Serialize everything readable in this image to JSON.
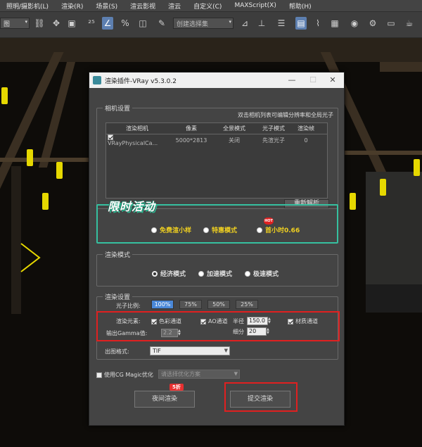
{
  "menubar": {
    "items": [
      "照明/摄影机(L)",
      "渲染(R)",
      "场景(S)",
      "渲云影视",
      "渲云",
      "自定义(C)",
      "MAXScript(X)",
      "帮助(H)"
    ]
  },
  "toolbar": {
    "view_select": "图",
    "named_selection": "创建选择集"
  },
  "dialog": {
    "title": "渲染插件-VRay v5.3.0.2",
    "minimize": "—",
    "maximize": "☐",
    "close": "✕",
    "camera": {
      "group_title": "相机设置",
      "hint": "双击相机列表可编辑分辨率和全局光子",
      "columns": [
        "渲染相机",
        "像素",
        "全景模式",
        "光子模式",
        "渲染帧"
      ],
      "rows": [
        {
          "camera": "VRayPhysicalCa...",
          "pixels": "5000*2813",
          "panorama": "关闭",
          "photon": "先渲光子",
          "frame": "0"
        }
      ],
      "reparse": "重新解析"
    },
    "promo": {
      "title": "限时活动",
      "options": [
        "免费渲小样",
        "特惠模式",
        "首小时0.66"
      ],
      "hot": "HOT"
    },
    "render_mode": {
      "group_title": "渲染模式",
      "options": [
        "经济模式",
        "加速模式",
        "极速模式"
      ]
    },
    "render_settings": {
      "group_title": "渲染设置",
      "photon_ratio_label": "光子比例:",
      "ratios": [
        "100%",
        "75%",
        "50%",
        "25%"
      ],
      "elements_label": "渲染元素:",
      "color_channel": "色彩通道",
      "ao_channel": "AO通道",
      "radius_label": "半径",
      "radius_value": "150.0",
      "material_channel": "材质通道",
      "gamma_label": "输出Gamma值:",
      "gamma_value": "2.2",
      "subdiv_label": "细分",
      "subdiv_value": "20",
      "format_label": "出图格式:",
      "format_value": "TIF"
    },
    "cg_magic": {
      "label": "使用CG Magic优化",
      "placeholder": "请选择优化方案"
    },
    "night_render": "夜间渲染",
    "discount": "5折",
    "submit": "提交渲染"
  }
}
